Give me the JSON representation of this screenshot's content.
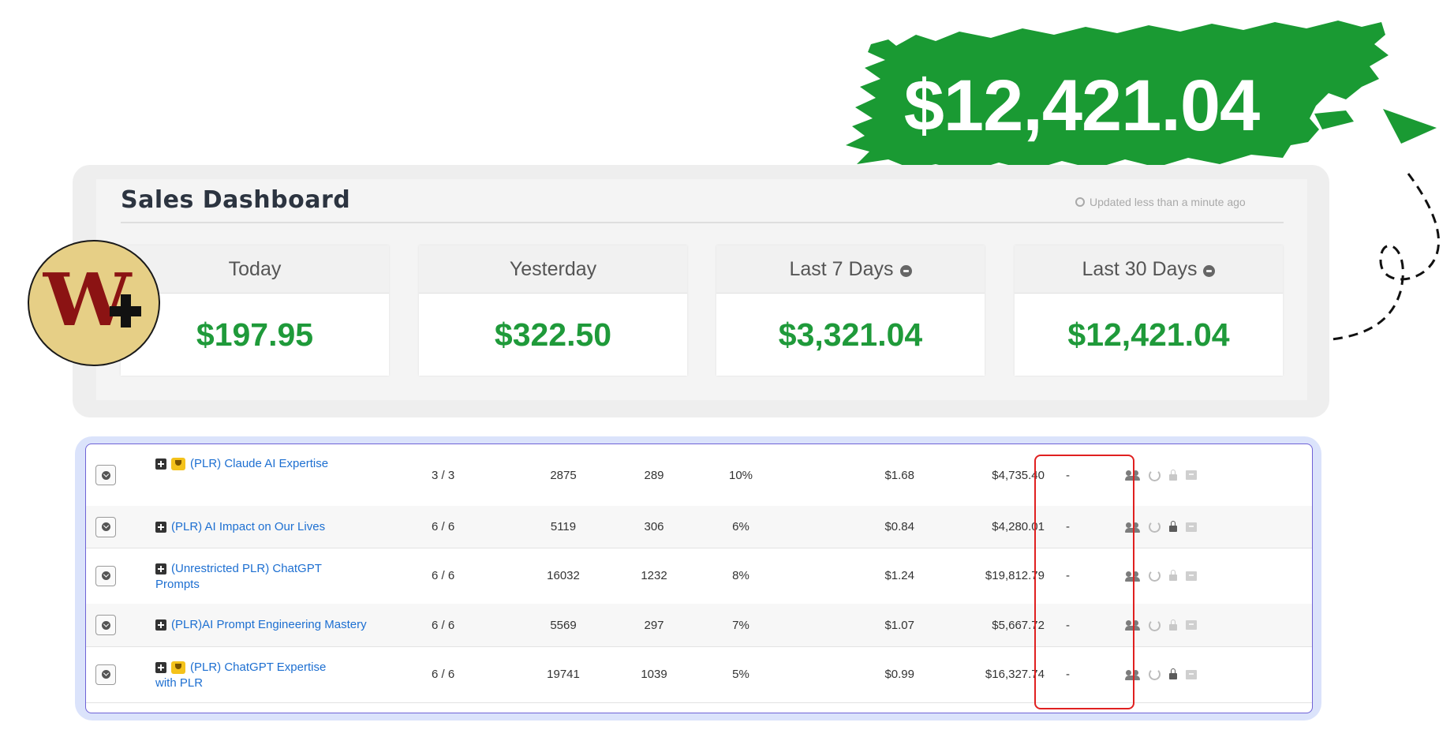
{
  "banner": {
    "amount": "$12,421.04",
    "color": "#1a9a33"
  },
  "dashboard": {
    "title": "Sales Dashboard",
    "updated": "Updated less than a minute ago",
    "cards": [
      {
        "label": "Today",
        "value": "$197.95",
        "info": false
      },
      {
        "label": "Yesterday",
        "value": "$322.50",
        "info": false
      },
      {
        "label": "Last 7 Days",
        "value": "$3,321.04",
        "info": true
      },
      {
        "label": "Last 30 Days",
        "value": "$12,421.04",
        "info": true
      }
    ],
    "value_color": "#1f9a3a"
  },
  "logo": {
    "letter": "W"
  },
  "table": {
    "rows": [
      {
        "name": "(PLR) Claude AI Expertise",
        "name_cont": "",
        "trophy": true,
        "ratio": "3 / 3",
        "n1": "2875",
        "n2": "289",
        "pct": "10%",
        "epc": "$1.68",
        "revenue": "$4,735.40",
        "dash": "-",
        "lock_dark": false
      },
      {
        "name": "(PLR) AI Impact on Our Lives",
        "name_cont": "",
        "trophy": false,
        "ratio": "6 / 6",
        "n1": "5119",
        "n2": "306",
        "pct": "6%",
        "epc": "$0.84",
        "revenue": "$4,280.01",
        "dash": "-",
        "lock_dark": true
      },
      {
        "name": "(Unrestricted PLR) ChatGPT",
        "name_cont": "Prompts",
        "trophy": false,
        "ratio": "6 / 6",
        "n1": "16032",
        "n2": "1232",
        "pct": "8%",
        "epc": "$1.24",
        "revenue": "$19,812.79",
        "dash": "-",
        "lock_dark": false
      },
      {
        "name": "(PLR)AI Prompt Engineering Mastery",
        "name_cont": "",
        "trophy": false,
        "ratio": "6 / 6",
        "n1": "5569",
        "n2": "297",
        "pct": "7%",
        "epc": "$1.07",
        "revenue": "$5,667.72",
        "dash": "-",
        "lock_dark": false
      },
      {
        "name": "(PLR) ChatGPT Expertise",
        "name_cont": "with PLR",
        "trophy": true,
        "ratio": "6 / 6",
        "n1": "19741",
        "n2": "1039",
        "pct": "5%",
        "epc": "$0.99",
        "revenue": "$16,327.74",
        "dash": "-",
        "lock_dark": true
      }
    ],
    "highlight_color": "#e02020",
    "link_color": "#1d6fd1"
  },
  "icons": [
    "clock-icon",
    "info-icon",
    "expand-icon",
    "plus-icon",
    "trophy-icon",
    "users-icon",
    "refresh-icon",
    "lock-icon",
    "archive-icon"
  ]
}
